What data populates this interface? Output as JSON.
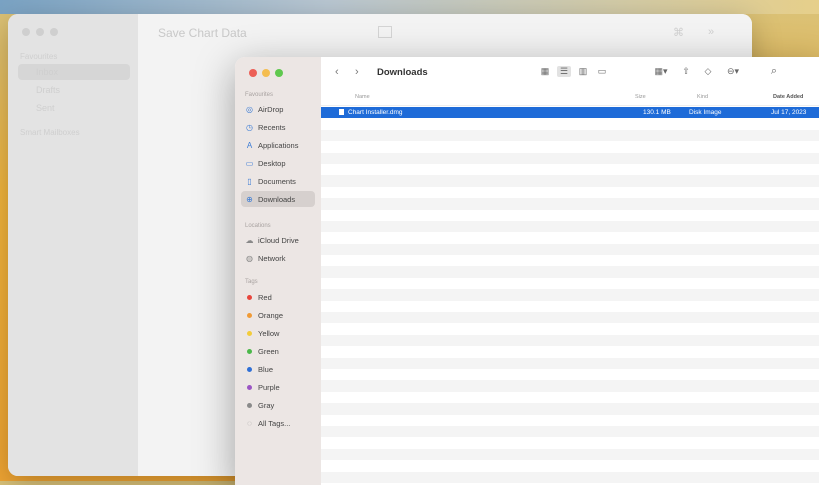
{
  "colors": {
    "selection": "#1e6bd8",
    "close": "#ec5f56",
    "minimize": "#f4bd4f",
    "zoom": "#5fc84e"
  },
  "back_window": {
    "title": "Save Chart Data",
    "sidebar_section": "Favourites",
    "sidebar_items": [
      "Inbox",
      "Drafts",
      "Sent"
    ],
    "sidebar_section2": "Smart Mailboxes"
  },
  "finder": {
    "title": "Downloads",
    "nav": {
      "back": "‹",
      "forward": "›"
    },
    "toolbar_icons": {
      "grid": "▦",
      "list": "☰",
      "columns": "▥",
      "gallery": "▭",
      "group": "▦▾",
      "share": "⇧",
      "tag": "◇",
      "more": "⊖▾",
      "search": "⌕"
    },
    "sidebar": {
      "favourites_label": "Favourites",
      "favourites": [
        {
          "icon": "airdrop-icon",
          "glyph": "◎",
          "label": "AirDrop"
        },
        {
          "icon": "recents-icon",
          "glyph": "◷",
          "label": "Recents"
        },
        {
          "icon": "applications-icon",
          "glyph": "A",
          "label": "Applications"
        },
        {
          "icon": "desktop-icon",
          "glyph": "▭",
          "label": "Desktop"
        },
        {
          "icon": "documents-icon",
          "glyph": "▯",
          "label": "Documents"
        },
        {
          "icon": "downloads-icon",
          "glyph": "⊕",
          "label": "Downloads"
        }
      ],
      "locations_label": "Locations",
      "locations": [
        {
          "icon": "icloud-icon",
          "glyph": "☁",
          "label": "iCloud Drive"
        },
        {
          "icon": "network-icon",
          "glyph": "◍",
          "label": "Network"
        }
      ],
      "tags_label": "Tags",
      "tags": [
        {
          "label": "Red",
          "color": "#e8453c"
        },
        {
          "label": "Orange",
          "color": "#f09a36"
        },
        {
          "label": "Yellow",
          "color": "#f3cc3a"
        },
        {
          "label": "Green",
          "color": "#4bb84a"
        },
        {
          "label": "Blue",
          "color": "#2f6fd6"
        },
        {
          "label": "Purple",
          "color": "#9b55c4"
        },
        {
          "label": "Gray",
          "color": "#8a8a8a"
        }
      ],
      "all_tags": "All Tags..."
    },
    "columns": {
      "name": "Name",
      "size": "Size",
      "kind": "Kind",
      "date": "Date Added"
    },
    "files": [
      {
        "name": "Chart Installer.dmg",
        "size": "130.1 MB",
        "kind": "Disk Image",
        "date": "Jul 17, 2023"
      }
    ]
  }
}
